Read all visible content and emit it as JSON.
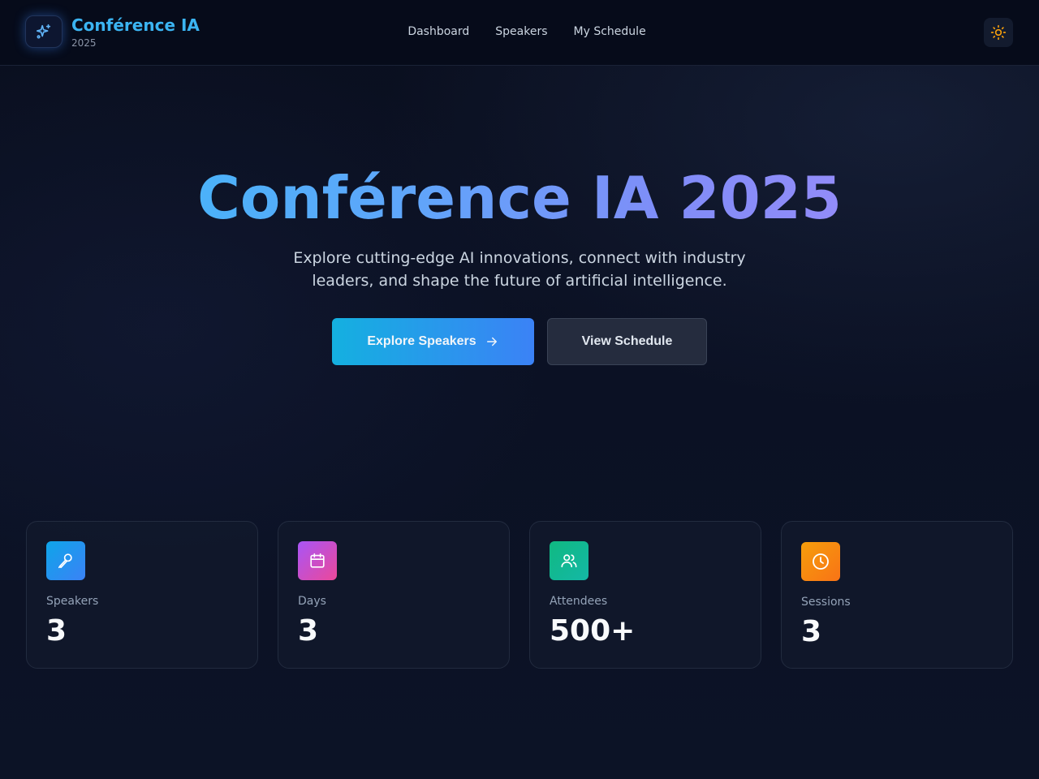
{
  "header": {
    "brand_title": "Conférence IA",
    "brand_year": "2025",
    "logo_icon": "sparkles-icon",
    "nav": [
      "Dashboard",
      "Speakers",
      "My Schedule"
    ],
    "theme_icon": "sun-icon"
  },
  "hero": {
    "title": "Conférence IA 2025",
    "subtitle": "Explore cutting-edge AI innovations, connect with industry leaders, and shape the future of artificial intelligence.",
    "primary_button": "Explore Speakers",
    "primary_icon": "arrow-right-icon",
    "secondary_button": "View Schedule"
  },
  "stats": [
    {
      "label": "Speakers",
      "value": "3",
      "icon": "microphone-icon",
      "color_from": "#0ea5e9",
      "color_to": "#3b82f6"
    },
    {
      "label": "Days",
      "value": "3",
      "icon": "calendar-icon",
      "color_from": "#a855f7",
      "color_to": "#ec4899"
    },
    {
      "label": "Attendees",
      "value": "500+",
      "icon": "users-icon",
      "color_from": "#10b981",
      "color_to": "#14b8a6"
    },
    {
      "label": "Sessions",
      "value": "3",
      "icon": "clock-icon",
      "color_from": "#f59e0b",
      "color_to": "#f97316"
    }
  ],
  "colors": {
    "accent": "#3bb4f2",
    "background": "#0b1122",
    "theme_icon": "#f59e0b"
  }
}
